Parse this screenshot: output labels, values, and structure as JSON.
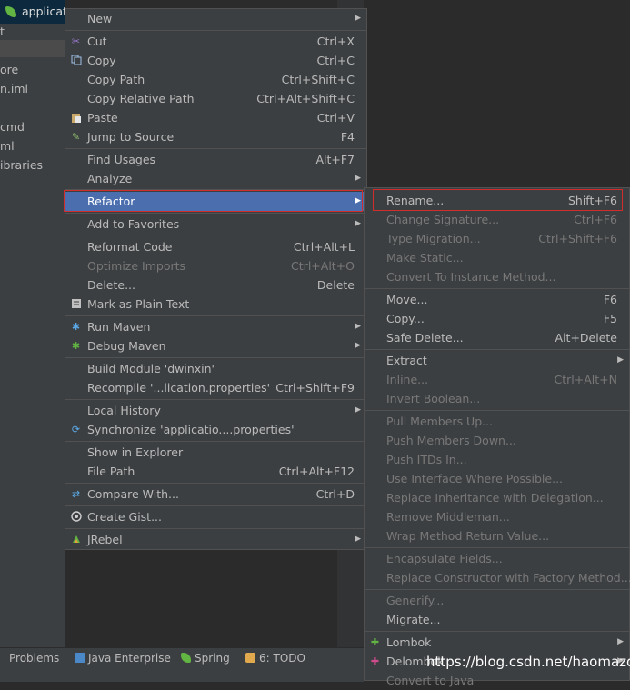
{
  "project_panel": {
    "header": "applicati",
    "tree_items": [
      "t",
      "ore",
      "n.iml",
      "cmd",
      "ml",
      "ibraries"
    ]
  },
  "bottom_toolbar": {
    "problems": "Problems",
    "java_enterprise": "Java Enterprise",
    "spring": "Spring",
    "todo": "6: TODO"
  },
  "context_menu": {
    "items": [
      {
        "label": "New",
        "shortcut": "",
        "icon": "",
        "submenu": true
      },
      {
        "label": "Cut",
        "shortcut": "Ctrl+X",
        "icon": "scissors-icon"
      },
      {
        "label": "Copy",
        "shortcut": "Ctrl+C",
        "icon": "copy-icon"
      },
      {
        "label": "Copy Path",
        "shortcut": "Ctrl+Shift+C"
      },
      {
        "label": "Copy Relative Path",
        "shortcut": "Ctrl+Alt+Shift+C"
      },
      {
        "label": "Paste",
        "shortcut": "Ctrl+V",
        "icon": "paste-icon"
      },
      {
        "label": "Jump to Source",
        "shortcut": "F4",
        "icon": "edit-icon"
      },
      {
        "label": "Find Usages",
        "shortcut": "Alt+F7"
      },
      {
        "label": "Analyze",
        "shortcut": "",
        "submenu": true
      },
      {
        "label": "Refactor",
        "shortcut": "",
        "submenu": true
      },
      {
        "label": "Add to Favorites",
        "shortcut": "",
        "submenu": true
      },
      {
        "label": "Reformat Code",
        "shortcut": "Ctrl+Alt+L"
      },
      {
        "label": "Optimize Imports",
        "shortcut": "Ctrl+Alt+O"
      },
      {
        "label": "Delete...",
        "shortcut": "Delete"
      },
      {
        "label": "Mark as Plain Text",
        "shortcut": "",
        "icon": "plain-text-icon"
      },
      {
        "label": "Run Maven",
        "shortcut": "",
        "icon": "maven-run-icon",
        "submenu": true
      },
      {
        "label": "Debug Maven",
        "shortcut": "",
        "icon": "maven-debug-icon",
        "submenu": true
      },
      {
        "label": "Build Module 'dwinxin'",
        "shortcut": ""
      },
      {
        "label": "Recompile '...lication.properties'",
        "shortcut": "Ctrl+Shift+F9"
      },
      {
        "label": "Local History",
        "shortcut": "",
        "submenu": true
      },
      {
        "label": "Synchronize 'applicatio....properties'",
        "shortcut": "",
        "icon": "sync-icon"
      },
      {
        "label": "Show in Explorer",
        "shortcut": ""
      },
      {
        "label": "File Path",
        "shortcut": "Ctrl+Alt+F12"
      },
      {
        "label": "Compare With...",
        "shortcut": "Ctrl+D",
        "icon": "compare-icon"
      },
      {
        "label": "Create Gist...",
        "shortcut": "",
        "icon": "github-icon"
      },
      {
        "label": "JRebel",
        "shortcut": "",
        "icon": "jrebel-icon",
        "submenu": true
      }
    ]
  },
  "refactor_menu": {
    "items": [
      {
        "label": "Rename...",
        "shortcut": "Shift+F6"
      },
      {
        "label": "Change Signature...",
        "shortcut": "Ctrl+F6"
      },
      {
        "label": "Type Migration...",
        "shortcut": "Ctrl+Shift+F6"
      },
      {
        "label": "Make Static...",
        "shortcut": ""
      },
      {
        "label": "Convert To Instance Method...",
        "shortcut": ""
      },
      {
        "label": "Move...",
        "shortcut": "F6"
      },
      {
        "label": "Copy...",
        "shortcut": "F5"
      },
      {
        "label": "Safe Delete...",
        "shortcut": "Alt+Delete"
      },
      {
        "label": "Extract",
        "shortcut": "",
        "submenu": true
      },
      {
        "label": "Inline...",
        "shortcut": "Ctrl+Alt+N"
      },
      {
        "label": "Invert Boolean...",
        "shortcut": ""
      },
      {
        "label": "Pull Members Up...",
        "shortcut": ""
      },
      {
        "label": "Push Members Down...",
        "shortcut": ""
      },
      {
        "label": "Push ITDs In...",
        "shortcut": ""
      },
      {
        "label": "Use Interface Where Possible...",
        "shortcut": ""
      },
      {
        "label": "Replace Inheritance with Delegation...",
        "shortcut": ""
      },
      {
        "label": "Remove Middleman...",
        "shortcut": ""
      },
      {
        "label": "Wrap Method Return Value...",
        "shortcut": ""
      },
      {
        "label": "Encapsulate Fields...",
        "shortcut": ""
      },
      {
        "label": "Replace Constructor with Factory Method...",
        "shortcut": ""
      },
      {
        "label": "Generify...",
        "shortcut": ""
      },
      {
        "label": "Migrate...",
        "shortcut": ""
      },
      {
        "label": "Lombok",
        "shortcut": "",
        "icon": "lombok-icon",
        "submenu": true
      },
      {
        "label": "Delombok",
        "shortcut": "",
        "icon": "delombok-icon",
        "submenu": true
      },
      {
        "label": "Convert to Java",
        "shortcut": ""
      }
    ]
  },
  "watermark": "https://blog.csdn.net/haomazdi",
  "colors": {
    "menu_bg": "#3c3f41",
    "highlight": "#4b6eaf",
    "annotation_red": "#d22d2d",
    "disabled_text": "#787878"
  }
}
